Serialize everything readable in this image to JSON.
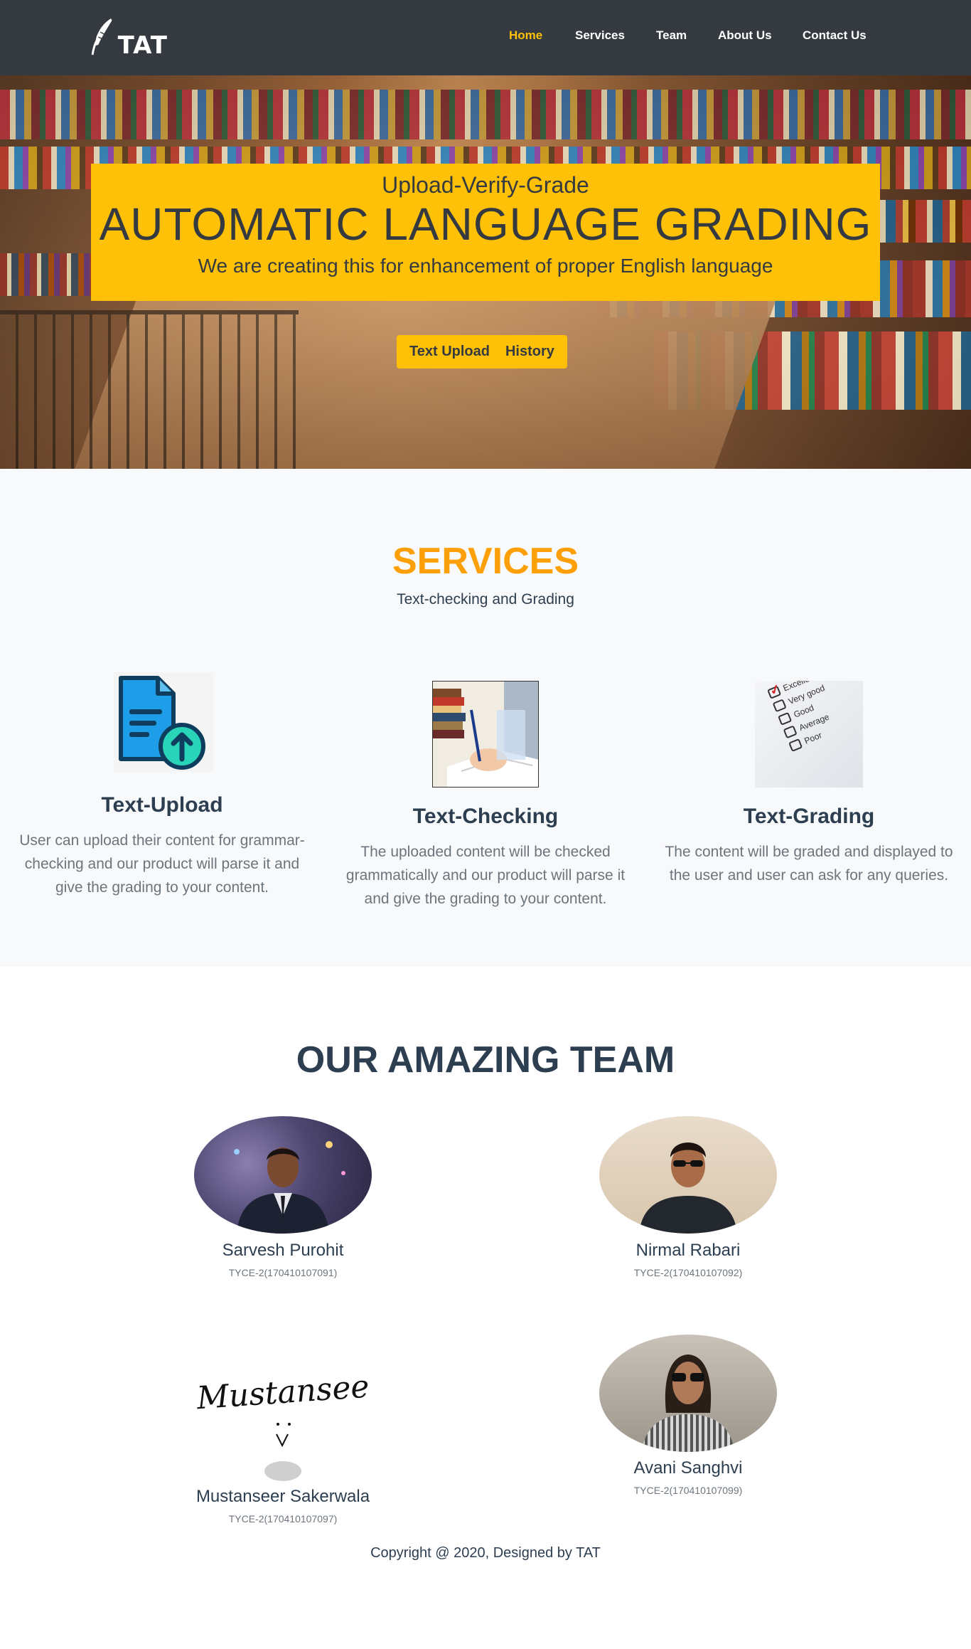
{
  "navbar": {
    "logo_text": "TAT",
    "links": [
      {
        "label": "Home",
        "active": true
      },
      {
        "label": "Services",
        "active": false
      },
      {
        "label": "Team",
        "active": false
      },
      {
        "label": "About Us",
        "active": false
      },
      {
        "label": "Contact Us",
        "active": false
      }
    ]
  },
  "hero": {
    "tagline": "Upload-Verify-Grade",
    "title": "AUTOMATIC LANGUAGE GRADING",
    "subtitle": "We are creating this for enhancement of proper English language",
    "buttons": [
      "Text Upload",
      "History"
    ]
  },
  "services": {
    "title": "SERVICES",
    "subtitle": "Text-checking and Grading",
    "items": [
      {
        "icon": "document-upload-icon",
        "heading": "Text-Upload",
        "text": "User can upload their content for grammar-checking and our product will parse it and give the grading to your content."
      },
      {
        "icon": "writing-books-image",
        "heading": "Text-Checking",
        "text": "The uploaded content will be checked grammatically and our product will parse it and give the grading to your content."
      },
      {
        "icon": "grading-checklist-image",
        "heading": "Text-Grading",
        "text": "The content will be graded and displayed to the user and user can ask for any queries."
      }
    ],
    "checklist": [
      "Excellent",
      "Very good",
      "Good",
      "Average",
      "Poor"
    ]
  },
  "team": {
    "title": "OUR AMAZING TEAM",
    "members": [
      {
        "name": "Sarvesh Purohit",
        "id": "TYCE-2(170410107091)"
      },
      {
        "name": "Nirmal Rabari",
        "id": "TYCE-2(170410107092)"
      },
      {
        "name": "Mustanseer Sakerwala",
        "id": "TYCE-2(170410107097)",
        "signature": "Mustanseer"
      },
      {
        "name": "Avani Sanghvi",
        "id": "TYCE-2(170410107099)"
      }
    ]
  },
  "footer": {
    "text": "Copyright @ 2020, Designed by TAT"
  },
  "colors": {
    "navbar_bg": "#343a40",
    "accent": "#fec107",
    "services_title": "#fd9f07",
    "heading": "#2c3e50",
    "muted": "#6c757d"
  }
}
